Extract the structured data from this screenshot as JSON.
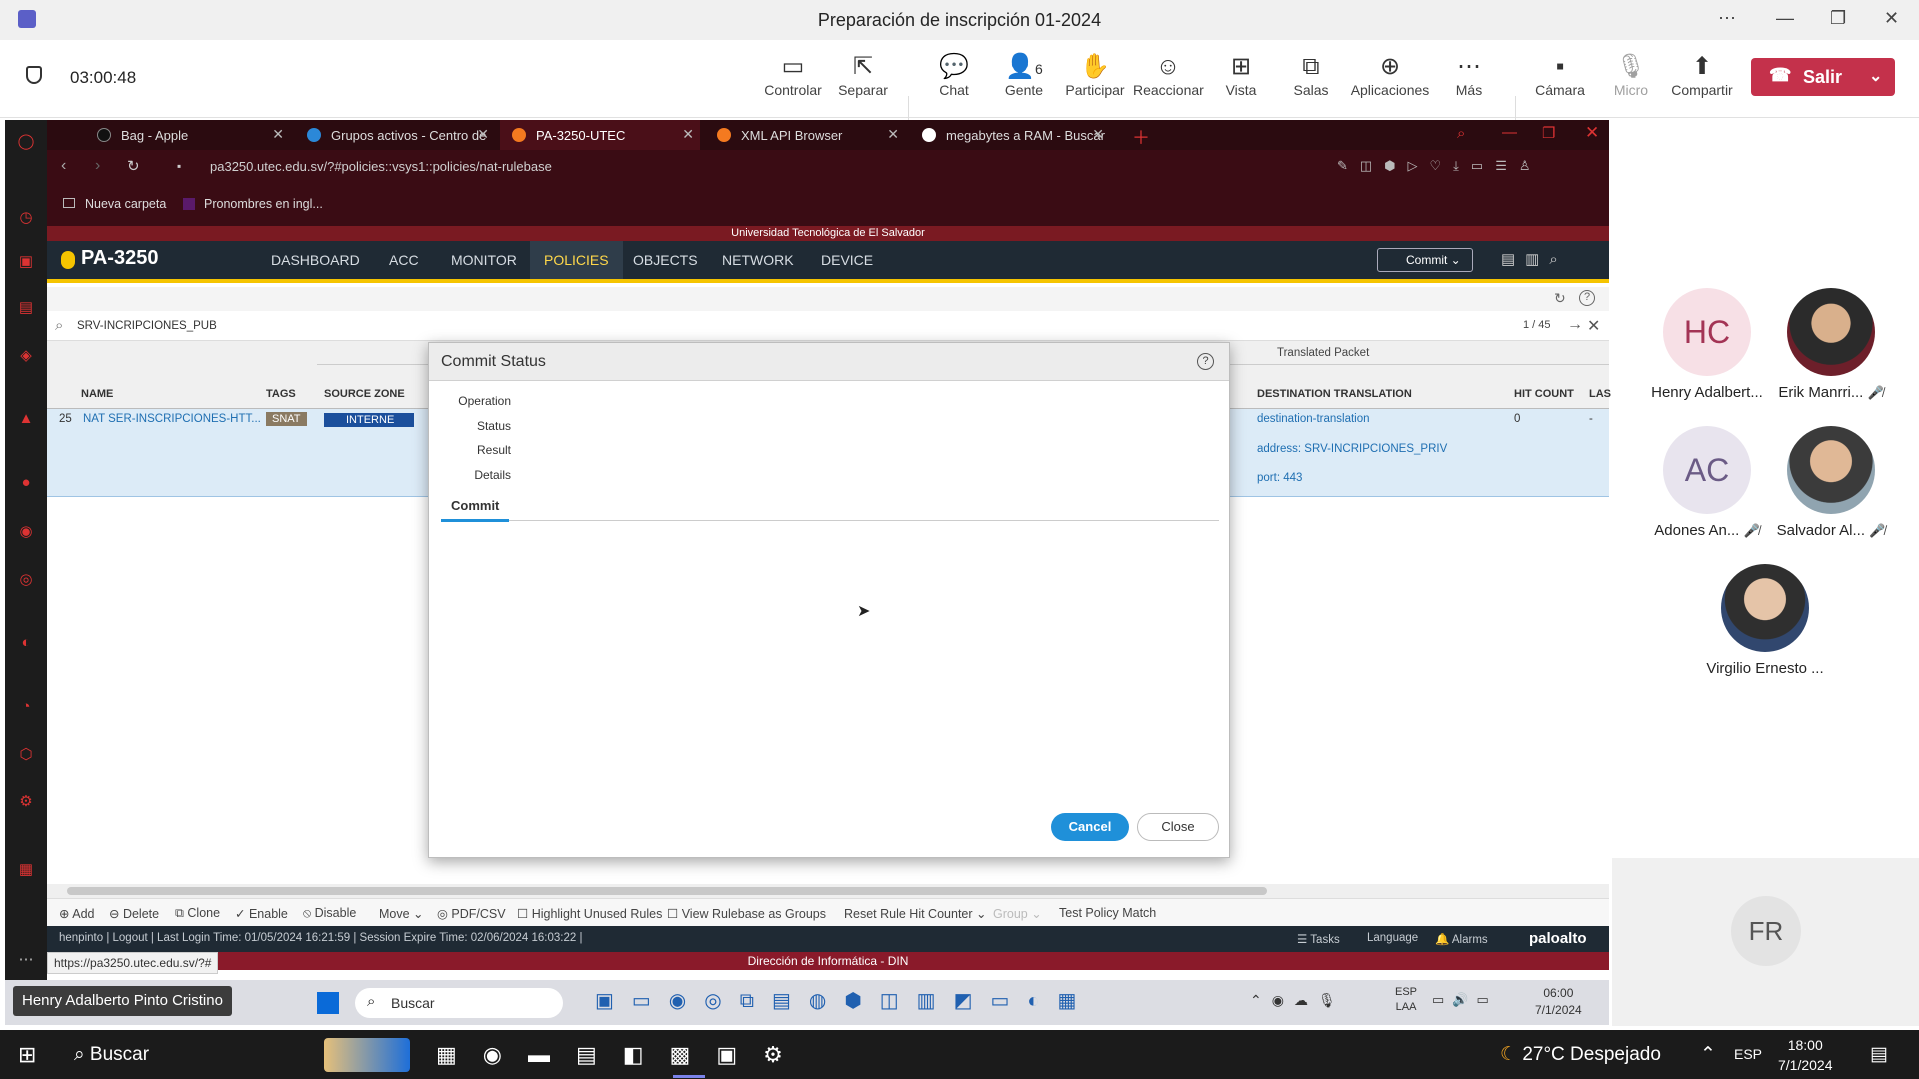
{
  "teams": {
    "window_title": "Preparación de inscripción 01-2024",
    "timer": "03:00:48",
    "toolbar": [
      {
        "label": "Controlar",
        "icon": "share-control-icon"
      },
      {
        "label": "Separar",
        "icon": "popout-icon"
      },
      {
        "label": "Chat",
        "icon": "chat-icon"
      },
      {
        "label": "Gente",
        "icon": "people-icon",
        "count": "6"
      },
      {
        "label": "Participar",
        "icon": "raise-hand-icon"
      },
      {
        "label": "Reaccionar",
        "icon": "smile-icon"
      },
      {
        "label": "Vista",
        "icon": "grid-view-icon"
      },
      {
        "label": "Salas",
        "icon": "rooms-icon"
      },
      {
        "label": "Aplicaciones",
        "icon": "add-apps-icon"
      },
      {
        "label": "Más",
        "icon": "more-icon"
      },
      {
        "label": "Cámara",
        "icon": "camera-off-icon"
      },
      {
        "label": "Micro",
        "icon": "mic-off-icon"
      },
      {
        "label": "Compartir",
        "icon": "share-icon"
      }
    ],
    "leave_label": "Salir",
    "presenter_name": "Henry Adalberto Pinto Cristino",
    "participants": [
      {
        "initials": "HC",
        "name": "Henry Adalbert...",
        "muted": false
      },
      {
        "initials": "",
        "name": "Erik Manrri...",
        "muted": true
      },
      {
        "initials": "AC",
        "name": "Adones An...",
        "muted": true
      },
      {
        "initials": "",
        "name": "Salvador Al...",
        "muted": true
      },
      {
        "initials": "",
        "name": "Virgilio Ernesto ...",
        "muted": false
      }
    ],
    "extra_tile_initials": "FR",
    "accent_color": "#c4314b"
  },
  "browser": {
    "tabs": [
      {
        "label": "Bag - Apple",
        "active": false
      },
      {
        "label": "Grupos activos - Centro de",
        "active": false
      },
      {
        "label": "PA-3250-UTEC",
        "active": true
      },
      {
        "label": "XML API Browser",
        "active": false
      },
      {
        "label": "megabytes a RAM - Buscar",
        "active": false
      }
    ],
    "url": "pa3250.utec.edu.sv/?#policies::vsys1::policies/nat-rulebase",
    "bookmarks": [
      "Nueva carpeta",
      "Pronombres en ingl..."
    ],
    "hover_url": "https://pa3250.utec.edu.sv/?#"
  },
  "paloalto": {
    "university_banner": "Universidad Tecnológica de El Salvador",
    "device_name": "PA-3250",
    "nav": [
      "DASHBOARD",
      "ACC",
      "MONITOR",
      "POLICIES",
      "OBJECTS",
      "NETWORK",
      "DEVICE"
    ],
    "active_nav": "POLICIES",
    "commit_label": "Commit",
    "filter_text": "SRV-INCRIPCIONES_PUB",
    "page_count": "1 / 45",
    "group_header": "Translated Packet",
    "columns": [
      "NAME",
      "TAGS",
      "SOURCE ZONE",
      "DESTINATION TRANSLATION",
      "HIT COUNT",
      "LAS"
    ],
    "row": {
      "number": "25",
      "name": "NAT SER-INSCRIPCIONES-HTT...",
      "tag": "SNAT",
      "source_zone": "INTERNE",
      "dest_translation": [
        "destination-translation",
        "address: SRV-INCRIPCIONES_PRIV",
        "port: 443"
      ],
      "hit_count": "0",
      "last": "-"
    },
    "bottom_actions": [
      "Add",
      "Delete",
      "Clone",
      "Enable",
      "Disable",
      "Move",
      "PDF/CSV",
      "Highlight Unused Rules",
      "View Rulebase as Groups",
      "Reset Rule Hit Counter",
      "Group",
      "Test Policy Match"
    ],
    "status_left": "henpinto | Logout | Last Login Time: 01/05/2024 16:21:59 | Session Expire Time: 02/06/2024 16:03:22 |",
    "status_right": [
      "Tasks",
      "Language",
      "Alarms"
    ],
    "brand": "paloalto",
    "footer_banner": "Dirección de Informática - DIN"
  },
  "modal": {
    "title": "Commit Status",
    "labels": [
      "Operation",
      "Status",
      "Result",
      "Details"
    ],
    "tab": "Commit",
    "cancel_label": "Cancel",
    "close_label": "Close"
  },
  "inner_taskbar": {
    "search": "Buscar",
    "lang": "ESP",
    "lang2": "LAA",
    "time": "06:00",
    "date": "7/1/2024"
  },
  "windows_taskbar": {
    "search": "Buscar",
    "weather": "27°C Despejado",
    "lang": "ESP",
    "time": "18:00",
    "date": "7/1/2024"
  }
}
